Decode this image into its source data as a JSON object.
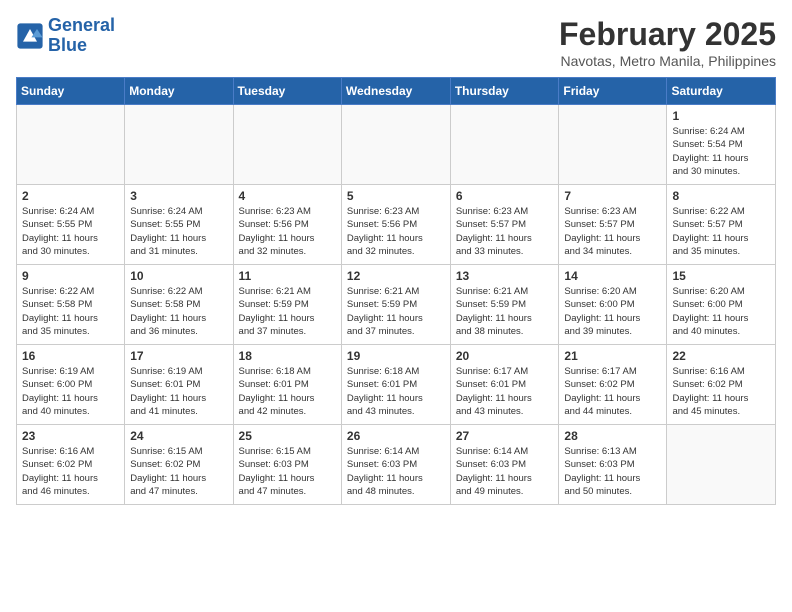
{
  "header": {
    "logo_line1": "General",
    "logo_line2": "Blue",
    "month": "February 2025",
    "location": "Navotas, Metro Manila, Philippines"
  },
  "weekdays": [
    "Sunday",
    "Monday",
    "Tuesday",
    "Wednesday",
    "Thursday",
    "Friday",
    "Saturday"
  ],
  "weeks": [
    [
      {
        "day": "",
        "info": ""
      },
      {
        "day": "",
        "info": ""
      },
      {
        "day": "",
        "info": ""
      },
      {
        "day": "",
        "info": ""
      },
      {
        "day": "",
        "info": ""
      },
      {
        "day": "",
        "info": ""
      },
      {
        "day": "1",
        "info": "Sunrise: 6:24 AM\nSunset: 5:54 PM\nDaylight: 11 hours\nand 30 minutes."
      }
    ],
    [
      {
        "day": "2",
        "info": "Sunrise: 6:24 AM\nSunset: 5:55 PM\nDaylight: 11 hours\nand 30 minutes."
      },
      {
        "day": "3",
        "info": "Sunrise: 6:24 AM\nSunset: 5:55 PM\nDaylight: 11 hours\nand 31 minutes."
      },
      {
        "day": "4",
        "info": "Sunrise: 6:23 AM\nSunset: 5:56 PM\nDaylight: 11 hours\nand 32 minutes."
      },
      {
        "day": "5",
        "info": "Sunrise: 6:23 AM\nSunset: 5:56 PM\nDaylight: 11 hours\nand 32 minutes."
      },
      {
        "day": "6",
        "info": "Sunrise: 6:23 AM\nSunset: 5:57 PM\nDaylight: 11 hours\nand 33 minutes."
      },
      {
        "day": "7",
        "info": "Sunrise: 6:23 AM\nSunset: 5:57 PM\nDaylight: 11 hours\nand 34 minutes."
      },
      {
        "day": "8",
        "info": "Sunrise: 6:22 AM\nSunset: 5:57 PM\nDaylight: 11 hours\nand 35 minutes."
      }
    ],
    [
      {
        "day": "9",
        "info": "Sunrise: 6:22 AM\nSunset: 5:58 PM\nDaylight: 11 hours\nand 35 minutes."
      },
      {
        "day": "10",
        "info": "Sunrise: 6:22 AM\nSunset: 5:58 PM\nDaylight: 11 hours\nand 36 minutes."
      },
      {
        "day": "11",
        "info": "Sunrise: 6:21 AM\nSunset: 5:59 PM\nDaylight: 11 hours\nand 37 minutes."
      },
      {
        "day": "12",
        "info": "Sunrise: 6:21 AM\nSunset: 5:59 PM\nDaylight: 11 hours\nand 37 minutes."
      },
      {
        "day": "13",
        "info": "Sunrise: 6:21 AM\nSunset: 5:59 PM\nDaylight: 11 hours\nand 38 minutes."
      },
      {
        "day": "14",
        "info": "Sunrise: 6:20 AM\nSunset: 6:00 PM\nDaylight: 11 hours\nand 39 minutes."
      },
      {
        "day": "15",
        "info": "Sunrise: 6:20 AM\nSunset: 6:00 PM\nDaylight: 11 hours\nand 40 minutes."
      }
    ],
    [
      {
        "day": "16",
        "info": "Sunrise: 6:19 AM\nSunset: 6:00 PM\nDaylight: 11 hours\nand 40 minutes."
      },
      {
        "day": "17",
        "info": "Sunrise: 6:19 AM\nSunset: 6:01 PM\nDaylight: 11 hours\nand 41 minutes."
      },
      {
        "day": "18",
        "info": "Sunrise: 6:18 AM\nSunset: 6:01 PM\nDaylight: 11 hours\nand 42 minutes."
      },
      {
        "day": "19",
        "info": "Sunrise: 6:18 AM\nSunset: 6:01 PM\nDaylight: 11 hours\nand 43 minutes."
      },
      {
        "day": "20",
        "info": "Sunrise: 6:17 AM\nSunset: 6:01 PM\nDaylight: 11 hours\nand 43 minutes."
      },
      {
        "day": "21",
        "info": "Sunrise: 6:17 AM\nSunset: 6:02 PM\nDaylight: 11 hours\nand 44 minutes."
      },
      {
        "day": "22",
        "info": "Sunrise: 6:16 AM\nSunset: 6:02 PM\nDaylight: 11 hours\nand 45 minutes."
      }
    ],
    [
      {
        "day": "23",
        "info": "Sunrise: 6:16 AM\nSunset: 6:02 PM\nDaylight: 11 hours\nand 46 minutes."
      },
      {
        "day": "24",
        "info": "Sunrise: 6:15 AM\nSunset: 6:02 PM\nDaylight: 11 hours\nand 47 minutes."
      },
      {
        "day": "25",
        "info": "Sunrise: 6:15 AM\nSunset: 6:03 PM\nDaylight: 11 hours\nand 47 minutes."
      },
      {
        "day": "26",
        "info": "Sunrise: 6:14 AM\nSunset: 6:03 PM\nDaylight: 11 hours\nand 48 minutes."
      },
      {
        "day": "27",
        "info": "Sunrise: 6:14 AM\nSunset: 6:03 PM\nDaylight: 11 hours\nand 49 minutes."
      },
      {
        "day": "28",
        "info": "Sunrise: 6:13 AM\nSunset: 6:03 PM\nDaylight: 11 hours\nand 50 minutes."
      },
      {
        "day": "",
        "info": ""
      }
    ]
  ]
}
